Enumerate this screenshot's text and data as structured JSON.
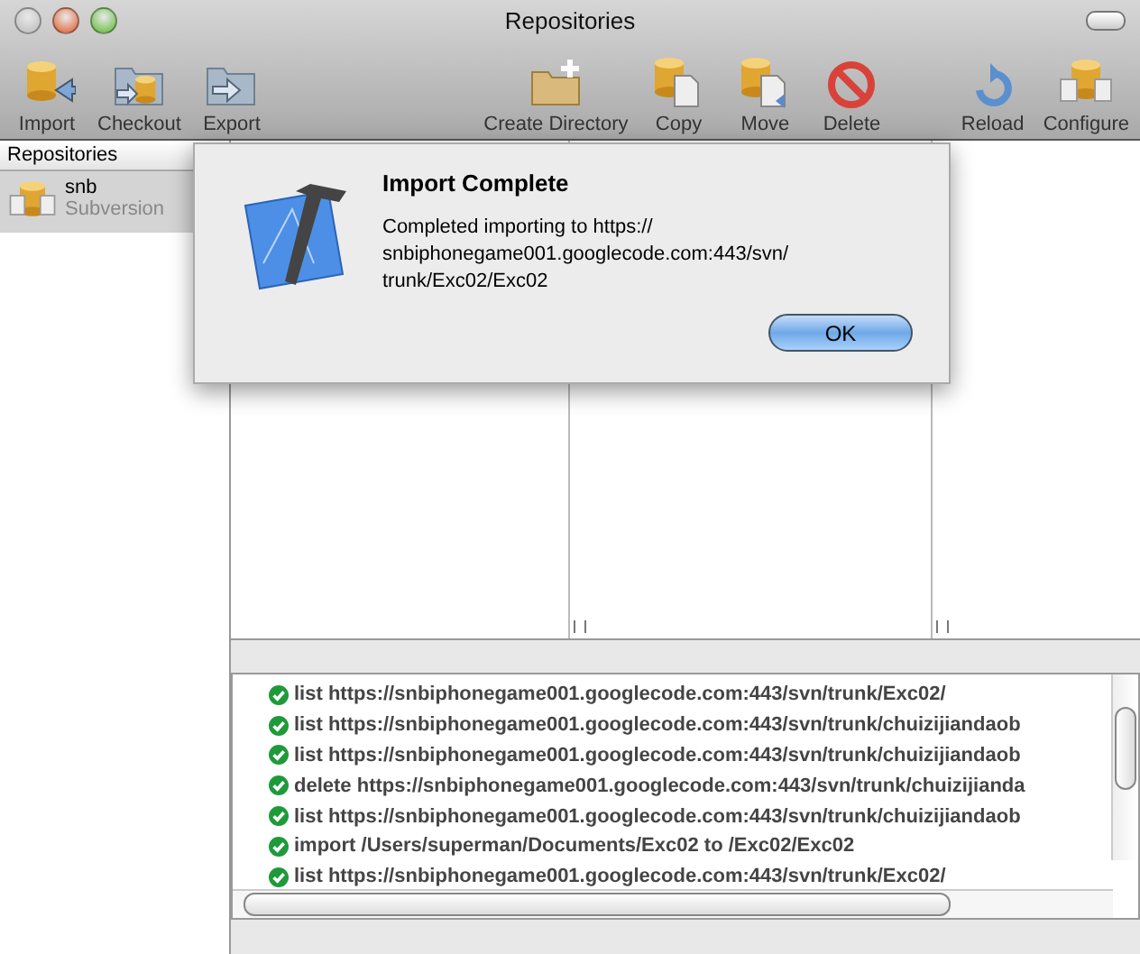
{
  "window": {
    "title": "Repositories"
  },
  "toolbar_groups": [
    [
      {
        "label": "Import",
        "kind": "import"
      },
      {
        "label": "Checkout",
        "kind": "checkout"
      },
      {
        "label": "Export",
        "kind": "export"
      }
    ],
    [
      {
        "label": "Create Directory",
        "kind": "newfolder"
      },
      {
        "label": "Copy",
        "kind": "copy"
      },
      {
        "label": "Move",
        "kind": "move"
      },
      {
        "label": "Delete",
        "kind": "delete"
      }
    ],
    [
      {
        "label": "Reload",
        "kind": "reload"
      },
      {
        "label": "Configure",
        "kind": "configure"
      }
    ]
  ],
  "sidebar": {
    "header": "Repositories",
    "items": [
      {
        "name": "snb",
        "type": "Subversion",
        "selected": true
      }
    ]
  },
  "dialog": {
    "title": "Import Complete",
    "message_lines": [
      "Completed importing to https://",
      "snbiphonegame001.googlecode.com:443/svn/",
      "trunk/Exc02/Exc02"
    ],
    "button": "OK"
  },
  "log": [
    {
      "succeeded": true,
      "text": "list https://snbiphonegame001.googlecode.com:443/svn/trunk/Exc02/"
    },
    {
      "succeeded": true,
      "text": "list https://snbiphonegame001.googlecode.com:443/svn/trunk/chuizijiandaob"
    },
    {
      "succeeded": true,
      "text": "list https://snbiphonegame001.googlecode.com:443/svn/trunk/chuizijiandaob"
    },
    {
      "succeeded": true,
      "text": "delete https://snbiphonegame001.googlecode.com:443/svn/trunk/chuizijianda"
    },
    {
      "succeeded": true,
      "text": "list https://snbiphonegame001.googlecode.com:443/svn/trunk/chuizijiandaob"
    },
    {
      "succeeded": true,
      "text": "import /Users/superman/Documents/Exc02 to /Exc02/Exc02"
    },
    {
      "succeeded": true,
      "text": "list https://snbiphonegame001.googlecode.com:443/svn/trunk/Exc02/"
    }
  ]
}
